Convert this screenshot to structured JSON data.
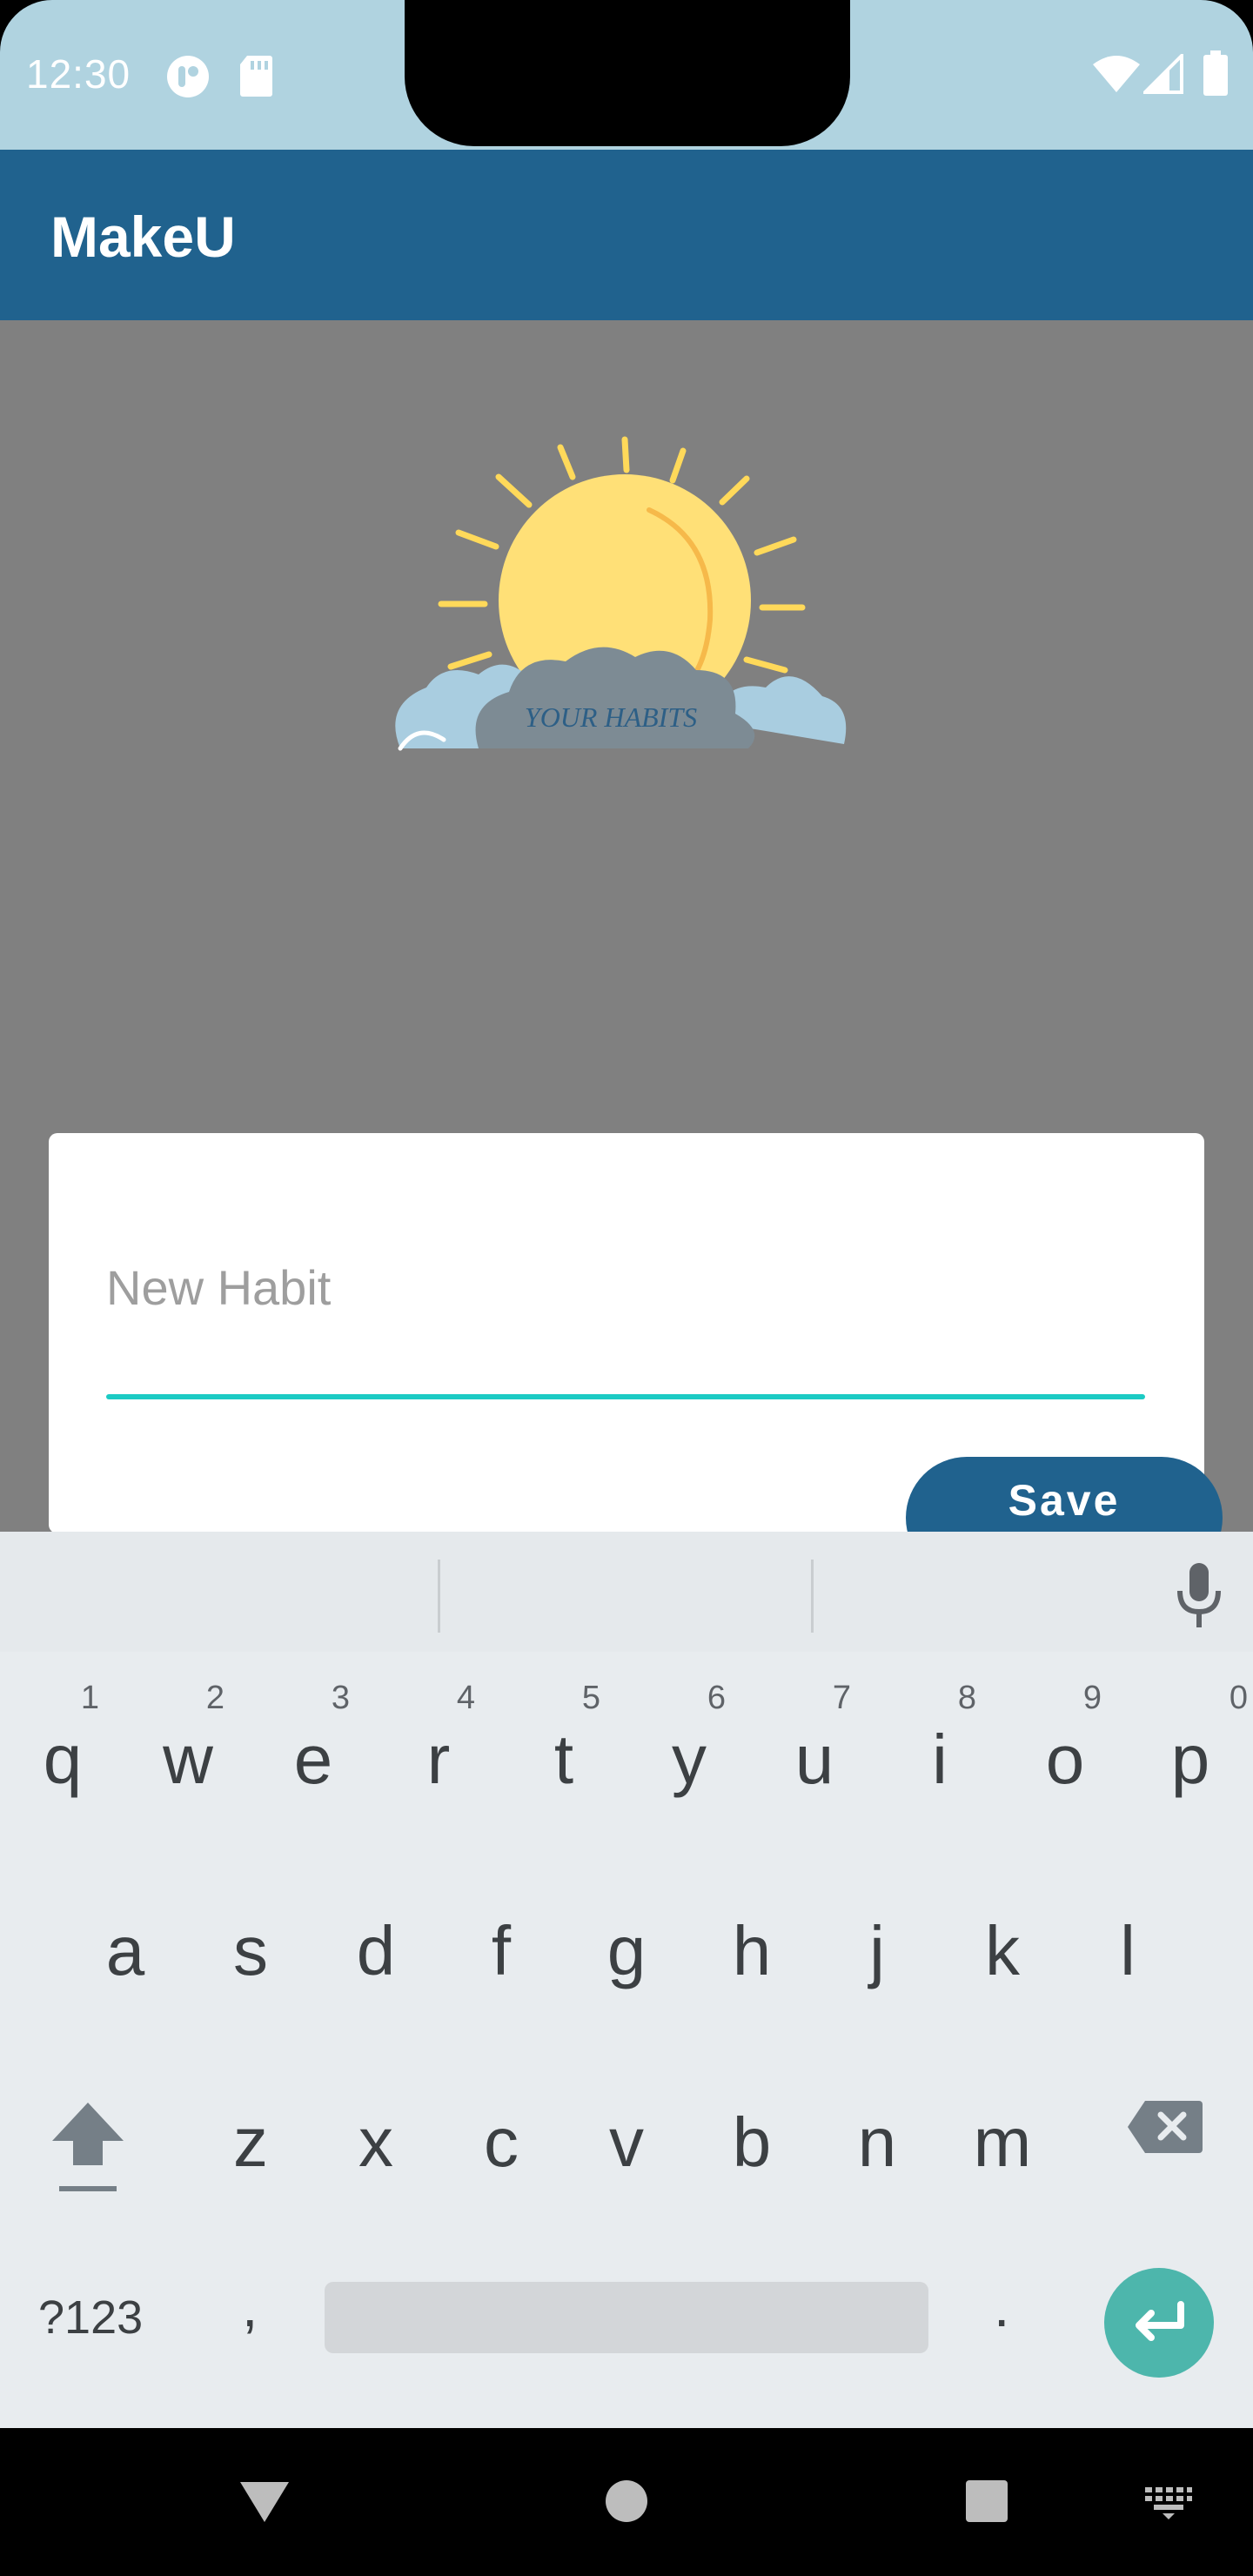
{
  "status_bar": {
    "time": "12:30",
    "icons": [
      "notification-icon",
      "sd-card-icon",
      "wifi-icon",
      "signal-icon",
      "battery-icon"
    ]
  },
  "app_bar": {
    "title": "MakeU"
  },
  "logo": {
    "text": "YOUR HABITS",
    "sun_color": "#ffe077",
    "cloud_color": "#a9cde0"
  },
  "dialog": {
    "input_placeholder": "New Habit",
    "input_value": "",
    "save_label": "Save"
  },
  "keyboard": {
    "row1": [
      {
        "letter": "q",
        "hint": "1"
      },
      {
        "letter": "w",
        "hint": "2"
      },
      {
        "letter": "e",
        "hint": "3"
      },
      {
        "letter": "r",
        "hint": "4"
      },
      {
        "letter": "t",
        "hint": "5"
      },
      {
        "letter": "y",
        "hint": "6"
      },
      {
        "letter": "u",
        "hint": "7"
      },
      {
        "letter": "i",
        "hint": "8"
      },
      {
        "letter": "o",
        "hint": "9"
      },
      {
        "letter": "p",
        "hint": "0"
      }
    ],
    "row2": [
      "a",
      "s",
      "d",
      "f",
      "g",
      "h",
      "j",
      "k",
      "l"
    ],
    "row3": [
      "z",
      "x",
      "c",
      "v",
      "b",
      "n",
      "m"
    ],
    "symbols_label": "?123",
    "comma": ",",
    "period": "."
  },
  "colors": {
    "app_bar": "#20628e",
    "status_bar": "#b0d3e0",
    "accent_underline": "#1ccbc4",
    "enter_key": "#4db6ac",
    "scrim": "#808080"
  }
}
